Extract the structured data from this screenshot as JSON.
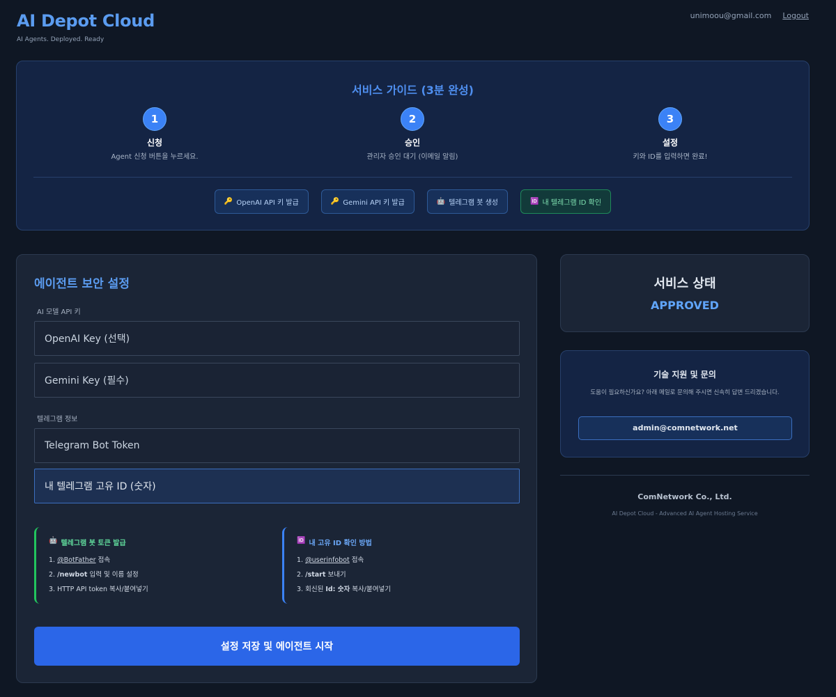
{
  "header": {
    "brand": "AI Depot Cloud",
    "tagline": "AI Agents. Deployed. Ready",
    "user_email": "unimoou@gmail.com",
    "logout_label": "Logout"
  },
  "guide": {
    "title": "서비스 가이드 (3분 완성)",
    "steps": [
      {
        "number": "1",
        "title": "신청",
        "desc": "Agent 신청 버튼을 누르세요."
      },
      {
        "number": "2",
        "title": "승인",
        "desc": "관리자 승인 대기 (이메일 알림)"
      },
      {
        "number": "3",
        "title": "설정",
        "desc": "키와 ID를 입력하면 완료!"
      }
    ],
    "buttons": [
      {
        "icon": "🔑",
        "label": "OpenAI API 키 발급"
      },
      {
        "icon": "🔑",
        "label": "Gemini API 키 발급"
      },
      {
        "icon": "🤖",
        "label": "텔레그램 봇 생성"
      },
      {
        "icon": "🆔",
        "label": "내 텔레그램 ID 확인"
      }
    ]
  },
  "form": {
    "title": "에이전트 보안 설정",
    "api_section_label": "AI 모델 API 키",
    "openai_placeholder": "OpenAI Key (선택)",
    "gemini_placeholder": "Gemini Key (필수)",
    "telegram_section_label": "텔레그램 정보",
    "bot_token_placeholder": "Telegram Bot Token",
    "telegram_id_placeholder": "내 텔레그램 고유 ID (숫자)",
    "info_bot": {
      "icon": "🤖",
      "title": "텔레그램 봇 토큰 발급",
      "line1_num": "1.",
      "line1_link": "@BotFather",
      "line1_rest": "접속",
      "line2_num": "2.",
      "line2_bold": "/newbot",
      "line2_rest": "입력 및 이름 설정",
      "line3": "3. HTTP API token 복사/붙여넣기"
    },
    "info_id": {
      "icon": "🆔",
      "title": "내 고유 ID 확인 방법",
      "line1_num": "1.",
      "line1_link": "@userinfobot",
      "line1_rest": "접속",
      "line2_num": "2.",
      "line2_bold": "/start",
      "line2_rest": "보내기",
      "line3_pre": "3. 회신된",
      "line3_bold": "Id: 숫자",
      "line3_rest": "복사/붙여넣기"
    },
    "submit_label": "설정 저장 및 에이전트 시작"
  },
  "status": {
    "title": "서비스 상태",
    "value": "APPROVED"
  },
  "support": {
    "title": "기술 지원 및 문의",
    "desc": "도움이 필요하신가요? 아래 메일로 문의해 주시면 신속히 답변 드리겠습니다.",
    "email": "admin@comnetwork.net"
  },
  "footer": {
    "company": "ComNetwork Co., Ltd.",
    "note": "AI Depot Cloud - Advanced AI Agent Hosting Service"
  }
}
